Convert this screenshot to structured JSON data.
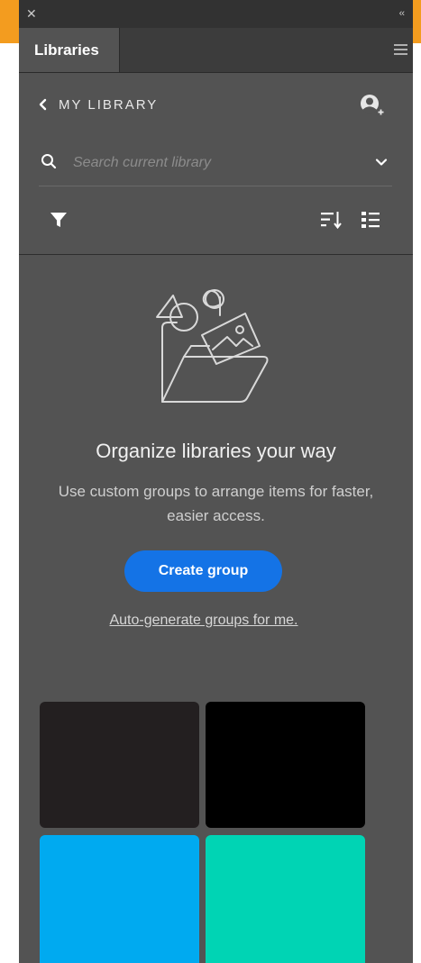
{
  "panel": {
    "tab_label": "Libraries",
    "close_icon": "close-icon",
    "collapse_icon": "double-chevron-left-icon",
    "menu_icon": "hamburger-menu-icon"
  },
  "header": {
    "back_label": "MY LIBRARY",
    "invite_icon": "invite-user-icon"
  },
  "search": {
    "placeholder": "Search current library",
    "value": ""
  },
  "toolbar": {
    "filter_icon": "filter-icon",
    "sort_icon": "sort-icon",
    "view_icon": "list-view-icon"
  },
  "empty_state": {
    "title": "Organize libraries your way",
    "description": "Use custom groups to arrange items for faster, easier access.",
    "create_button": "Create group",
    "auto_link": "Auto-generate groups for me."
  },
  "swatches": [
    {
      "color": "#231f20"
    },
    {
      "color": "#000000"
    },
    {
      "color": "#00aaf0"
    },
    {
      "color": "#00d4b4"
    }
  ],
  "colors": {
    "accent": "#1473e6",
    "panel_bg": "#535353",
    "app_bar": "#f39c1f"
  }
}
